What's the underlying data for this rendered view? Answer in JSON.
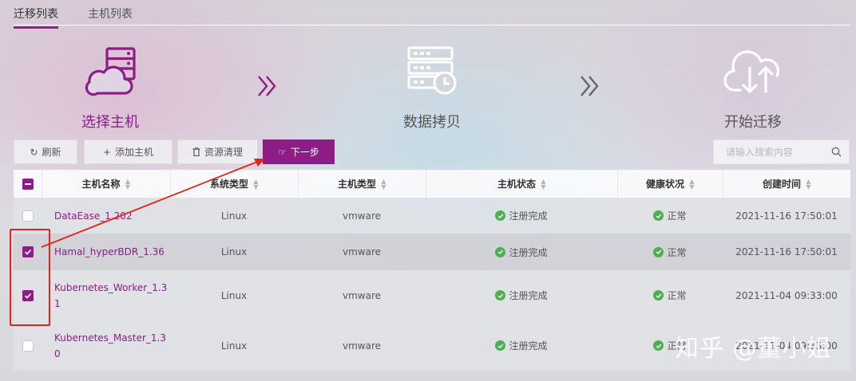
{
  "tabs": [
    {
      "label": "迁移列表",
      "active": true
    },
    {
      "label": "主机列表",
      "active": false
    }
  ],
  "steps": [
    {
      "label": "选择主机",
      "icon": "cloud-server-icon",
      "active": true
    },
    {
      "label": "数据拷贝",
      "icon": "server-clock-icon",
      "active": false
    },
    {
      "label": "开始迁移",
      "icon": "cloud-transfer-icon",
      "active": false
    }
  ],
  "toolbar": {
    "refresh_label": "刷新",
    "add_host_label": "添加主机",
    "cleanup_label": "资源清理",
    "next_label": "下一步"
  },
  "search": {
    "placeholder": "请输入搜索内容",
    "value": ""
  },
  "table": {
    "columns": [
      "主机名称",
      "系统类型",
      "主机类型",
      "主机状态",
      "健康状况",
      "创建时间"
    ],
    "rows": [
      {
        "checked": false,
        "name_lines": [
          "DataEase_1.202"
        ],
        "os": "Linux",
        "host_type": "vmware",
        "status": "注册完成",
        "health": "正常",
        "created": "2021-11-16 17:50:01"
      },
      {
        "checked": true,
        "name_lines": [
          "Hamal_hyperBDR_1.36"
        ],
        "os": "Linux",
        "host_type": "vmware",
        "status": "注册完成",
        "health": "正常",
        "created": "2021-11-16 17:50:01"
      },
      {
        "checked": true,
        "name_lines": [
          "Kubernetes_Worker_1.3",
          "1"
        ],
        "os": "Linux",
        "host_type": "vmware",
        "status": "注册完成",
        "health": "正常",
        "created": "2021-11-04 09:33:00"
      },
      {
        "checked": false,
        "name_lines": [
          "Kubernetes_Master_1.3",
          "0"
        ],
        "os": "Linux",
        "host_type": "vmware",
        "status": "注册完成",
        "health": "正常",
        "created": "2021-11-04 09:33:00"
      }
    ]
  },
  "watermark": "知乎 @董小姐",
  "colors": {
    "accent": "#8d1c86",
    "annotation": "#e3241b",
    "status_ok": "#4caf50"
  }
}
